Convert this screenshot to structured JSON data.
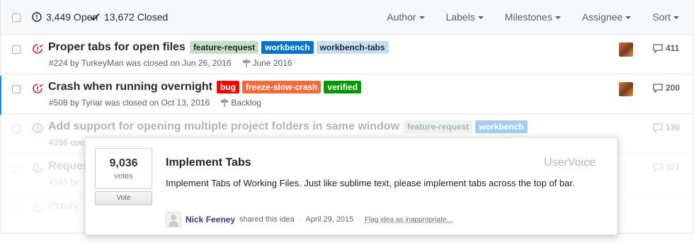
{
  "header": {
    "open_count": "3,449 Open",
    "closed_count": "13,672 Closed",
    "filters": [
      "Author",
      "Labels",
      "Milestones",
      "Assignee",
      "Sort"
    ]
  },
  "issues": [
    {
      "title": "Proper tabs for open files",
      "labels": [
        {
          "text": "feature-request",
          "bg": "#c2e0c6",
          "fg": "#24292e"
        },
        {
          "text": "workbench",
          "bg": "#0075ca",
          "fg": "#ffffff"
        },
        {
          "text": "workbench-tabs",
          "bg": "#c5def5",
          "fg": "#24292e"
        }
      ],
      "meta": "#224 by TurkeyMan was closed on Jun 26, 2016",
      "milestone": "June 2016",
      "comments": "411"
    },
    {
      "title": "Crash when running overnight",
      "labels": [
        {
          "text": "bug",
          "bg": "#ee0701",
          "fg": "#ffffff"
        },
        {
          "text": "freeze-slow-crash",
          "bg": "#f26b3a",
          "fg": "#ffffff"
        },
        {
          "text": "verified",
          "bg": "#009800",
          "fg": "#ffffff"
        }
      ],
      "meta": "#508 by Tyriar was closed on Oct 13, 2016",
      "milestone": "Backlog",
      "comments": "200"
    },
    {
      "title": "Add support for opening multiple project folders in same window",
      "labels": [
        {
          "text": "feature-request",
          "bg": "#c2e0c6",
          "fg": "#24292e"
        },
        {
          "text": "workbench",
          "bg": "#0075ca",
          "fg": "#ffffff"
        }
      ],
      "meta": "#396 ope",
      "comments": "130"
    },
    {
      "title": "Reques",
      "meta": "#143 by",
      "comments": "121"
    },
    {
      "title": "Proxy",
      "meta": ""
    }
  ],
  "popup": {
    "votes": "9,036",
    "votes_label": "votes",
    "vote_button": "Vote",
    "title": "Implement Tabs",
    "brand": "UserVoice",
    "description": "Implement Tabs of Working Files. Just like sublime text, please implement tabs across the top of bar.",
    "author": "Nick Feeney",
    "shared_text": "shared this idea",
    "date": "April 29, 2015",
    "flag_link": "Flag idea as inappropriate…"
  },
  "colors": {
    "closed_icon": "#cb2431",
    "open_icon": "#28a745",
    "accent": "#2188ff"
  }
}
